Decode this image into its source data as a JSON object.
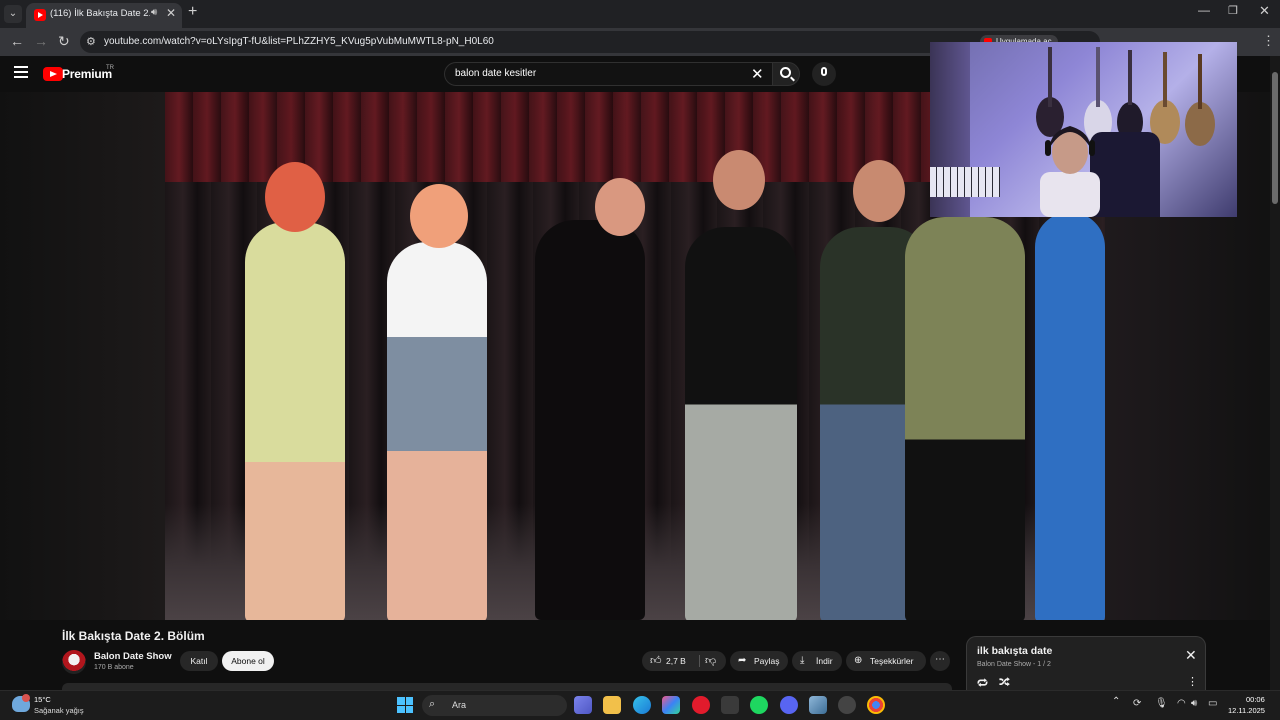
{
  "browser": {
    "tab_title": "(116) İlk Bakışta Date 2. Bö",
    "tab_audio_icon": "speaker-icon",
    "url": "youtube.com/watch?v=oLYsIpgT-fU&list=PLhZZHY5_KVug5pVubMuMWTL8-pN_H0L60",
    "extension_pill": "Uygulamada aç"
  },
  "youtube": {
    "logo_text": "Premium",
    "country_code": "TR",
    "search_value": "balon date kesitler",
    "video_title": "İlk Bakışta Date 2. Bölüm",
    "channel_name": "Balon Date Show",
    "channel_subs": "170 B abone",
    "join_label": "Katıl",
    "subscribe_label": "Abone ol",
    "like_count": "2,7 B",
    "share_label": "Paylaş",
    "download_label": "İndir",
    "thanks_label": "Teşekkürler",
    "playlist": {
      "title": "ilk bakışta date",
      "subtitle": "Balon Date Show - 1 / 2"
    }
  },
  "taskbar": {
    "weather_temp": "15°C",
    "weather_desc": "Sağanak yağış",
    "search_placeholder": "Ara",
    "time": "00:06",
    "date": "12.11.2025"
  },
  "colors": {
    "youtube_red": "#ff0000",
    "background": "#0f0f0f",
    "accent_blue": "#4cc2ff"
  }
}
